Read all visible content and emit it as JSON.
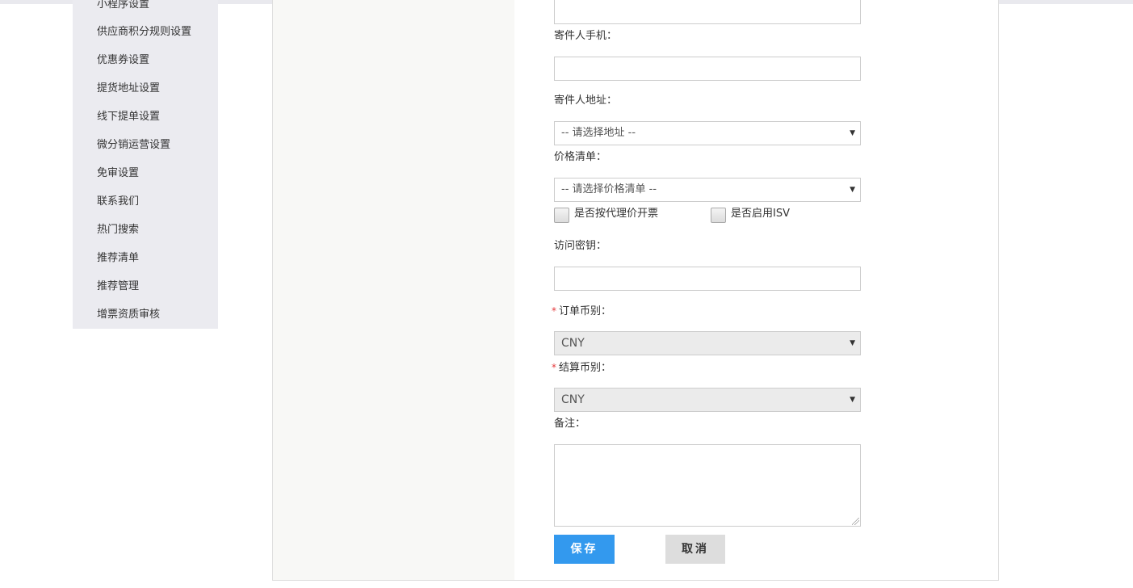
{
  "sidebar": {
    "items": [
      {
        "label": "小程序设置"
      },
      {
        "label": "供应商积分规则设置"
      },
      {
        "label": "优惠券设置"
      },
      {
        "label": "提货地址设置"
      },
      {
        "label": "线下提单设置"
      },
      {
        "label": "微分销运营设置"
      },
      {
        "label": "免审设置"
      },
      {
        "label": "联系我们"
      },
      {
        "label": "热门搜索"
      },
      {
        "label": "推荐清单"
      },
      {
        "label": "推荐管理"
      },
      {
        "label": "增票资质审核"
      }
    ]
  },
  "form": {
    "sender_phone_label": "寄件人手机：",
    "sender_phone_value": "",
    "sender_address_label": "寄件人地址：",
    "sender_address_select": "-- 请选择地址 --",
    "price_list_label": "价格清单：",
    "price_list_select": "-- 请选择价格清单 --",
    "agent_price_invoice_label": "是否按代理价开票",
    "enable_isv_label": "是否启用ISV",
    "access_key_label": "访问密钥：",
    "access_key_value": "",
    "required_mark": "*",
    "order_currency_label": "订单币别：",
    "order_currency_value": "CNY",
    "settle_currency_label": "结算币别：",
    "settle_currency_value": "CNY",
    "remark_label": "备注：",
    "remark_value": "",
    "caret_glyph": "▼"
  },
  "actions": {
    "save_label": "保存",
    "cancel_label": "取消"
  },
  "colors": {
    "primary": "#3399ee",
    "required": "#e4393c",
    "sidebar_bg": "#ebebf0"
  }
}
